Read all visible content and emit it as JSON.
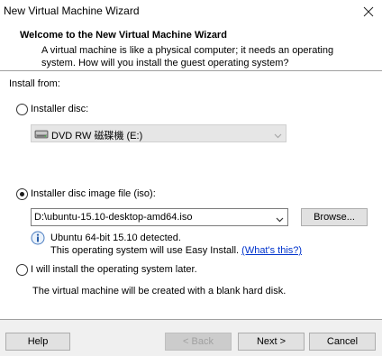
{
  "window": {
    "title": "New Virtual Machine Wizard",
    "close_icon": "close-icon"
  },
  "header": {
    "title": "Welcome to the New Virtual Machine Wizard",
    "description": "A virtual machine is like a physical computer; it needs an operating system. How will you install the guest operating system?"
  },
  "install_from": {
    "label": "Install from:",
    "disc_option": {
      "label": "Installer disc:",
      "selected": false,
      "drive_value": "DVD RW 磁碟機 (E:)",
      "drive_icon": "dvd-drive-icon"
    },
    "iso_option": {
      "label": "Installer disc image file (iso):",
      "selected": true,
      "path_value": "D:\\ubuntu-15.10-desktop-amd64.iso",
      "browse_label": "Browse...",
      "info_icon": "info-icon",
      "detected": "Ubuntu 64-bit 15.10 detected.",
      "easy_install": "This operating system will use Easy Install.",
      "whats_this": "(What's this?)"
    },
    "later_option": {
      "label": "I will install the operating system later.",
      "selected": false,
      "description": "The virtual machine will be created with a blank hard disk."
    }
  },
  "footer": {
    "help_label": "Help",
    "back_label": "< Back",
    "next_label": "Next >",
    "cancel_label": "Cancel"
  }
}
